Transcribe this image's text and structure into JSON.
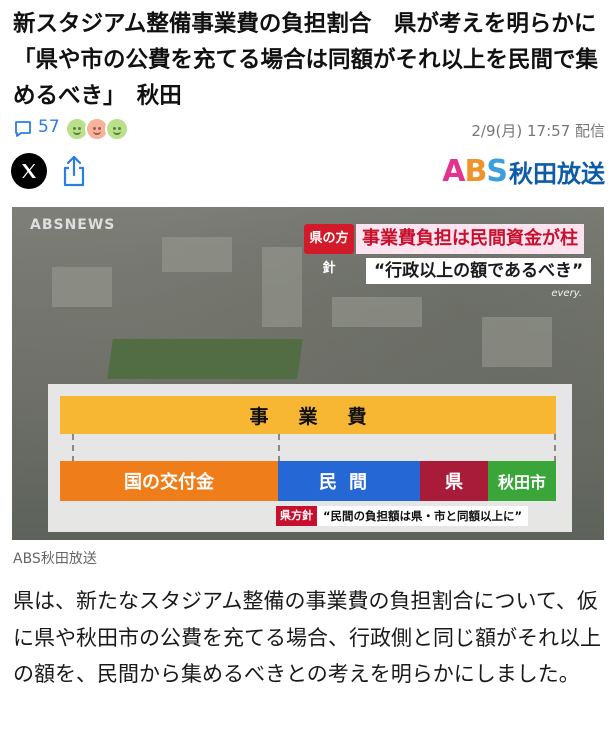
{
  "article": {
    "headline": "新スタジアム整備事業費の負担割合　県が考えを明らかに「県や市の公費を充てる場合は同額がそれ以上を民間で集めるべき」　秋田",
    "comment_count": "57",
    "datetime": "2/9(月) 17:57 配信",
    "image_credit": "ABS秋田放送",
    "body": "県は、新たなスタジアム整備の事業費の負担割合について、仮に県や秋田市の公費を充てる場合、行政側と同じ額がそれ以上の額を、民間から集めるべきとの考えを明らかにしました。"
  },
  "brand": {
    "abs_a": "A",
    "abs_b": "B",
    "abs_s": "S",
    "name": "秋田放送",
    "color_pink": "#e4338f",
    "color_orange": "#f0932b",
    "color_blue": "#3aa0e0"
  },
  "photo": {
    "watermark": "ABSNEWS",
    "policy_tag": "県の方針",
    "caption_line1": "事業費負担は民間資金が柱",
    "caption_line2": "“行政以上の額であるべき”",
    "program_mark": "every.",
    "board": {
      "total_label": "事業費",
      "segments": [
        {
          "label": "国の交付金",
          "color": "#ef7d1a"
        },
        {
          "label": "民間",
          "color": "#2567d4"
        },
        {
          "label": "県",
          "color": "#a81c3a"
        },
        {
          "label": "秋田市",
          "color": "#3aa63a"
        }
      ],
      "note_tag": "県方針",
      "note_text": "“民間の負担額は県・市と同額以上に”"
    }
  },
  "icons": {
    "comment": "comment-icon",
    "x": "x-logo-icon",
    "share": "share-icon"
  }
}
